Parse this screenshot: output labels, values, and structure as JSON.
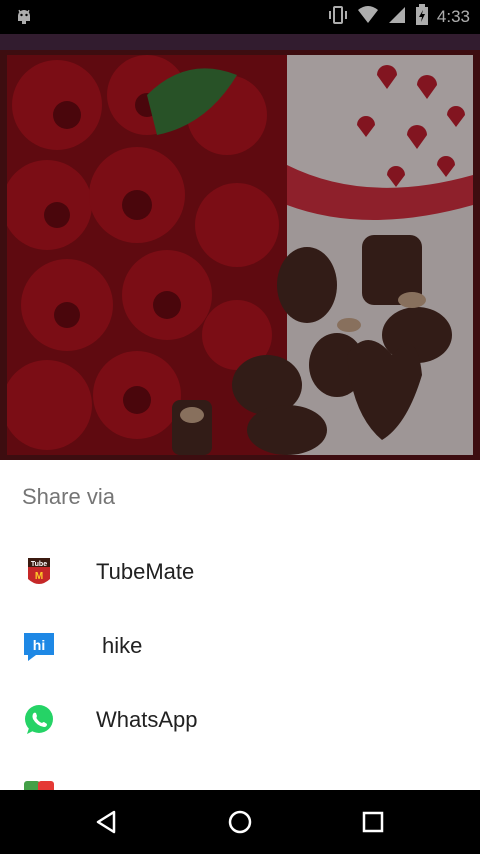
{
  "status_bar": {
    "time": "4:33",
    "icons": [
      "android-debug-icon",
      "vibrate-icon",
      "wifi-icon",
      "signal-icon",
      "battery-icon"
    ]
  },
  "background_image": {
    "description_name": "roses-and-chocolates-photo"
  },
  "share_sheet": {
    "title": "Share via",
    "items": [
      {
        "label": "TubeMate",
        "icon": "tubemate-icon"
      },
      {
        "label": "hike",
        "icon": "hike-icon"
      },
      {
        "label": "WhatsApp",
        "icon": "whatsapp-icon"
      },
      {
        "label": "",
        "icon": "instashare-icon"
      }
    ]
  },
  "nav_bar": {
    "buttons": [
      "back-icon",
      "home-icon",
      "recents-icon"
    ]
  },
  "colors": {
    "accent_strip": "#4a2a46",
    "whatsapp": "#25D366",
    "hike": "#1e88e5"
  }
}
